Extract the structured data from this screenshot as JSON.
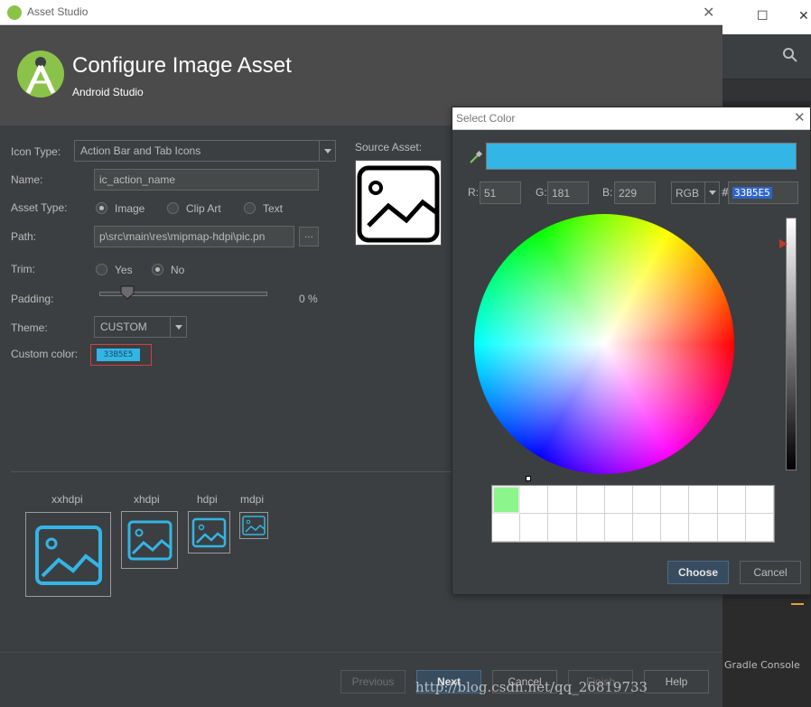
{
  "dialog": {
    "title": "Asset Studio",
    "header_title": "Configure Image Asset",
    "header_subtitle": "Android Studio"
  },
  "form": {
    "icon_type_label": "Icon Type:",
    "icon_type_value": "Action Bar and Tab Icons",
    "name_label": "Name:",
    "name_value": "ic_action_name",
    "asset_type_label": "Asset Type:",
    "asset_type_options": [
      "Image",
      "Clip Art",
      "Text"
    ],
    "asset_type_selected": "Image",
    "path_label": "Path:",
    "path_value": "p\\src\\main\\res\\mipmap-hdpi\\pic.pn",
    "browse_label": "...",
    "trim_label": "Trim:",
    "trim_options": [
      "Yes",
      "No"
    ],
    "trim_selected": "No",
    "padding_label": "Padding:",
    "padding_value": "0 %",
    "padding_percent": 0,
    "theme_label": "Theme:",
    "theme_value": "CUSTOM",
    "custom_color_label": "Custom color:",
    "custom_color_value": "33B5E5",
    "source_asset_label": "Source Asset:"
  },
  "preview": {
    "densities": [
      "xxhdpi",
      "xhdpi",
      "hdpi",
      "mdpi"
    ]
  },
  "footer": {
    "previous": "Previous",
    "next": "Next",
    "cancel": "Cancel",
    "finish": "Finish",
    "help": "Help"
  },
  "color_picker": {
    "title": "Select Color",
    "r_label": "R:",
    "r_value": "51",
    "g_label": "G:",
    "g_value": "181",
    "b_label": "B:",
    "b_value": "229",
    "mode": "RGB",
    "hash": "#",
    "hex_value": "33B5E5",
    "choose": "Choose",
    "cancel": "Cancel",
    "recent_colors": [
      "#8cf58c"
    ]
  },
  "background_ide": {
    "gradle_console": "Gradle Console"
  },
  "watermark": {
    "url": "http://blog.csdn.net/qq_26819733"
  },
  "colors": {
    "accent": "#33b5e5",
    "dialog_bg": "#3c3f41",
    "header_bg": "#4b4b4b",
    "android_green": "#8bc34a",
    "primary_button": "#384c60"
  }
}
